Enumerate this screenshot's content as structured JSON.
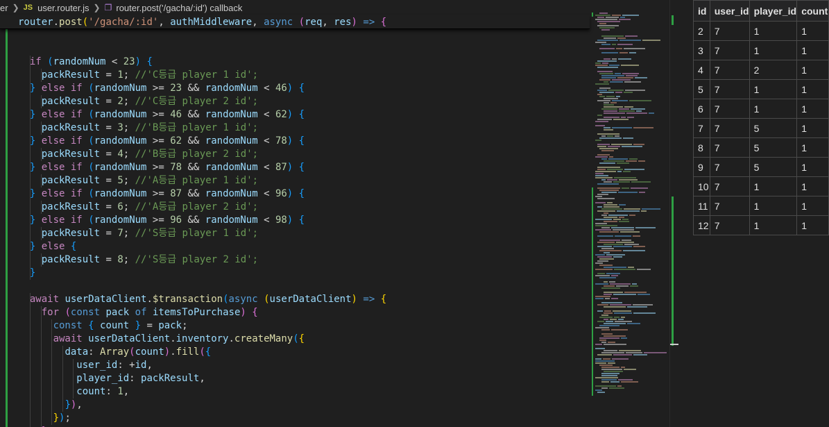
{
  "breadcrumb": {
    "parent": "er",
    "file_icon": "JS",
    "file": "user.router.js",
    "symbol": "router.post('/gacha/:id') callback"
  },
  "sticky_parts": [
    {
      "c": "var",
      "t": "router"
    },
    {
      "c": "op",
      "t": "."
    },
    {
      "c": "fn",
      "t": "post"
    },
    {
      "c": "b1",
      "t": "("
    },
    {
      "c": "str",
      "t": "'/gacha/:id'"
    },
    {
      "c": "op",
      "t": ", "
    },
    {
      "c": "var",
      "t": "authMiddleware"
    },
    {
      "c": "op",
      "t": ", "
    },
    {
      "c": "kb",
      "t": "async"
    },
    {
      "c": "op",
      "t": " "
    },
    {
      "c": "b2",
      "t": "("
    },
    {
      "c": "var",
      "t": "req"
    },
    {
      "c": "op",
      "t": ", "
    },
    {
      "c": "var",
      "t": "res"
    },
    {
      "c": "b2",
      "t": ")"
    },
    {
      "c": "op",
      "t": " "
    },
    {
      "c": "kb",
      "t": "=>"
    },
    {
      "c": "op",
      "t": " "
    },
    {
      "c": "b2",
      "t": "{"
    }
  ],
  "code_lines": [
    {
      "indent": 0,
      "parts": []
    },
    {
      "indent": 2,
      "parts": [
        {
          "c": "kw",
          "t": "if"
        },
        {
          "c": "op",
          "t": " "
        },
        {
          "c": "b3",
          "t": "("
        },
        {
          "c": "var",
          "t": "randomNum"
        },
        {
          "c": "op",
          "t": " < "
        },
        {
          "c": "num",
          "t": "23"
        },
        {
          "c": "b3",
          "t": ")"
        },
        {
          "c": "op",
          "t": " "
        },
        {
          "c": "b3",
          "t": "{"
        }
      ]
    },
    {
      "indent": 3,
      "parts": [
        {
          "c": "var",
          "t": "packResult"
        },
        {
          "c": "op",
          "t": " = "
        },
        {
          "c": "num",
          "t": "1"
        },
        {
          "c": "op",
          "t": "; "
        },
        {
          "c": "cm",
          "t": "//'C등급 player 1 id';"
        }
      ]
    },
    {
      "indent": 2,
      "parts": [
        {
          "c": "b3",
          "t": "}"
        },
        {
          "c": "op",
          "t": " "
        },
        {
          "c": "kw",
          "t": "else if"
        },
        {
          "c": "op",
          "t": " "
        },
        {
          "c": "b3",
          "t": "("
        },
        {
          "c": "var",
          "t": "randomNum"
        },
        {
          "c": "op",
          "t": " >= "
        },
        {
          "c": "num",
          "t": "23"
        },
        {
          "c": "op",
          "t": " && "
        },
        {
          "c": "var",
          "t": "randomNum"
        },
        {
          "c": "op",
          "t": " < "
        },
        {
          "c": "num",
          "t": "46"
        },
        {
          "c": "b3",
          "t": ")"
        },
        {
          "c": "op",
          "t": " "
        },
        {
          "c": "b3",
          "t": "{"
        }
      ]
    },
    {
      "indent": 3,
      "parts": [
        {
          "c": "var",
          "t": "packResult"
        },
        {
          "c": "op",
          "t": " = "
        },
        {
          "c": "num",
          "t": "2"
        },
        {
          "c": "op",
          "t": "; "
        },
        {
          "c": "cm",
          "t": "//'C등급 player 2 id';"
        }
      ]
    },
    {
      "indent": 2,
      "parts": [
        {
          "c": "b3",
          "t": "}"
        },
        {
          "c": "op",
          "t": " "
        },
        {
          "c": "kw",
          "t": "else if"
        },
        {
          "c": "op",
          "t": " "
        },
        {
          "c": "b3",
          "t": "("
        },
        {
          "c": "var",
          "t": "randomNum"
        },
        {
          "c": "op",
          "t": " >= "
        },
        {
          "c": "num",
          "t": "46"
        },
        {
          "c": "op",
          "t": " && "
        },
        {
          "c": "var",
          "t": "randomNum"
        },
        {
          "c": "op",
          "t": " < "
        },
        {
          "c": "num",
          "t": "62"
        },
        {
          "c": "b3",
          "t": ")"
        },
        {
          "c": "op",
          "t": " "
        },
        {
          "c": "b3",
          "t": "{"
        }
      ]
    },
    {
      "indent": 3,
      "parts": [
        {
          "c": "var",
          "t": "packResult"
        },
        {
          "c": "op",
          "t": " = "
        },
        {
          "c": "num",
          "t": "3"
        },
        {
          "c": "op",
          "t": "; "
        },
        {
          "c": "cm",
          "t": "//'B등급 player 1 id';"
        }
      ]
    },
    {
      "indent": 2,
      "parts": [
        {
          "c": "b3",
          "t": "}"
        },
        {
          "c": "op",
          "t": " "
        },
        {
          "c": "kw",
          "t": "else if"
        },
        {
          "c": "op",
          "t": " "
        },
        {
          "c": "b3",
          "t": "("
        },
        {
          "c": "var",
          "t": "randomNum"
        },
        {
          "c": "op",
          "t": " >= "
        },
        {
          "c": "num",
          "t": "62"
        },
        {
          "c": "op",
          "t": " && "
        },
        {
          "c": "var",
          "t": "randomNum"
        },
        {
          "c": "op",
          "t": " < "
        },
        {
          "c": "num",
          "t": "78"
        },
        {
          "c": "b3",
          "t": ")"
        },
        {
          "c": "op",
          "t": " "
        },
        {
          "c": "b3",
          "t": "{"
        }
      ]
    },
    {
      "indent": 3,
      "parts": [
        {
          "c": "var",
          "t": "packResult"
        },
        {
          "c": "op",
          "t": " = "
        },
        {
          "c": "num",
          "t": "4"
        },
        {
          "c": "op",
          "t": "; "
        },
        {
          "c": "cm",
          "t": "//'B등급 player 2 id';"
        }
      ]
    },
    {
      "indent": 2,
      "parts": [
        {
          "c": "b3",
          "t": "}"
        },
        {
          "c": "op",
          "t": " "
        },
        {
          "c": "kw",
          "t": "else if"
        },
        {
          "c": "op",
          "t": " "
        },
        {
          "c": "b3",
          "t": "("
        },
        {
          "c": "var",
          "t": "randomNum"
        },
        {
          "c": "op",
          "t": " >= "
        },
        {
          "c": "num",
          "t": "78"
        },
        {
          "c": "op",
          "t": " && "
        },
        {
          "c": "var",
          "t": "randomNum"
        },
        {
          "c": "op",
          "t": " < "
        },
        {
          "c": "num",
          "t": "87"
        },
        {
          "c": "b3",
          "t": ")"
        },
        {
          "c": "op",
          "t": " "
        },
        {
          "c": "b3",
          "t": "{"
        }
      ]
    },
    {
      "indent": 3,
      "parts": [
        {
          "c": "var",
          "t": "packResult"
        },
        {
          "c": "op",
          "t": " = "
        },
        {
          "c": "num",
          "t": "5"
        },
        {
          "c": "op",
          "t": "; "
        },
        {
          "c": "cm",
          "t": "//'A등급 player 1 id';"
        }
      ]
    },
    {
      "indent": 2,
      "parts": [
        {
          "c": "b3",
          "t": "}"
        },
        {
          "c": "op",
          "t": " "
        },
        {
          "c": "kw",
          "t": "else if"
        },
        {
          "c": "op",
          "t": " "
        },
        {
          "c": "b3",
          "t": "("
        },
        {
          "c": "var",
          "t": "randomNum"
        },
        {
          "c": "op",
          "t": " >= "
        },
        {
          "c": "num",
          "t": "87"
        },
        {
          "c": "op",
          "t": " && "
        },
        {
          "c": "var",
          "t": "randomNum"
        },
        {
          "c": "op",
          "t": " < "
        },
        {
          "c": "num",
          "t": "96"
        },
        {
          "c": "b3",
          "t": ")"
        },
        {
          "c": "op",
          "t": " "
        },
        {
          "c": "b3",
          "t": "{"
        }
      ]
    },
    {
      "indent": 3,
      "parts": [
        {
          "c": "var",
          "t": "packResult"
        },
        {
          "c": "op",
          "t": " = "
        },
        {
          "c": "num",
          "t": "6"
        },
        {
          "c": "op",
          "t": "; "
        },
        {
          "c": "cm",
          "t": "//'A등급 player 2 id';"
        }
      ]
    },
    {
      "indent": 2,
      "parts": [
        {
          "c": "b3",
          "t": "}"
        },
        {
          "c": "op",
          "t": " "
        },
        {
          "c": "kw",
          "t": "else if"
        },
        {
          "c": "op",
          "t": " "
        },
        {
          "c": "b3",
          "t": "("
        },
        {
          "c": "var",
          "t": "randomNum"
        },
        {
          "c": "op",
          "t": " >= "
        },
        {
          "c": "num",
          "t": "96"
        },
        {
          "c": "op",
          "t": " && "
        },
        {
          "c": "var",
          "t": "randomNum"
        },
        {
          "c": "op",
          "t": " < "
        },
        {
          "c": "num",
          "t": "98"
        },
        {
          "c": "b3",
          "t": ")"
        },
        {
          "c": "op",
          "t": " "
        },
        {
          "c": "b3",
          "t": "{"
        }
      ]
    },
    {
      "indent": 3,
      "parts": [
        {
          "c": "var",
          "t": "packResult"
        },
        {
          "c": "op",
          "t": " = "
        },
        {
          "c": "num",
          "t": "7"
        },
        {
          "c": "op",
          "t": "; "
        },
        {
          "c": "cm",
          "t": "//'S등급 player 1 id';"
        }
      ]
    },
    {
      "indent": 2,
      "parts": [
        {
          "c": "b3",
          "t": "}"
        },
        {
          "c": "op",
          "t": " "
        },
        {
          "c": "kw",
          "t": "else"
        },
        {
          "c": "op",
          "t": " "
        },
        {
          "c": "b3",
          "t": "{"
        }
      ]
    },
    {
      "indent": 3,
      "parts": [
        {
          "c": "var",
          "t": "packResult"
        },
        {
          "c": "op",
          "t": " = "
        },
        {
          "c": "num",
          "t": "8"
        },
        {
          "c": "op",
          "t": "; "
        },
        {
          "c": "cm",
          "t": "//'S등급 player 2 id';"
        }
      ]
    },
    {
      "indent": 2,
      "parts": [
        {
          "c": "b3",
          "t": "}"
        }
      ]
    },
    {
      "indent": 0,
      "parts": []
    },
    {
      "indent": 2,
      "parts": [
        {
          "c": "kw",
          "t": "await"
        },
        {
          "c": "op",
          "t": " "
        },
        {
          "c": "var",
          "t": "userDataClient"
        },
        {
          "c": "op",
          "t": "."
        },
        {
          "c": "fn",
          "t": "$transaction"
        },
        {
          "c": "b3",
          "t": "("
        },
        {
          "c": "kb",
          "t": "async"
        },
        {
          "c": "op",
          "t": " "
        },
        {
          "c": "b1",
          "t": "("
        },
        {
          "c": "var",
          "t": "userDataClient"
        },
        {
          "c": "b1",
          "t": ")"
        },
        {
          "c": "op",
          "t": " "
        },
        {
          "c": "kb",
          "t": "=>"
        },
        {
          "c": "op",
          "t": " "
        },
        {
          "c": "b1",
          "t": "{"
        }
      ]
    },
    {
      "indent": 3,
      "parts": [
        {
          "c": "kw",
          "t": "for"
        },
        {
          "c": "op",
          "t": " "
        },
        {
          "c": "b2",
          "t": "("
        },
        {
          "c": "kb",
          "t": "const"
        },
        {
          "c": "op",
          "t": " "
        },
        {
          "c": "var",
          "t": "pack"
        },
        {
          "c": "op",
          "t": " "
        },
        {
          "c": "kb",
          "t": "of"
        },
        {
          "c": "op",
          "t": " "
        },
        {
          "c": "var",
          "t": "itemsToPurchase"
        },
        {
          "c": "b2",
          "t": ")"
        },
        {
          "c": "op",
          "t": " "
        },
        {
          "c": "b2",
          "t": "{"
        }
      ]
    },
    {
      "indent": 4,
      "parts": [
        {
          "c": "kb",
          "t": "const"
        },
        {
          "c": "op",
          "t": " "
        },
        {
          "c": "b3",
          "t": "{"
        },
        {
          "c": "op",
          "t": " "
        },
        {
          "c": "var",
          "t": "count"
        },
        {
          "c": "op",
          "t": " "
        },
        {
          "c": "b3",
          "t": "}"
        },
        {
          "c": "op",
          "t": " = "
        },
        {
          "c": "var",
          "t": "pack"
        },
        {
          "c": "op",
          "t": ";"
        }
      ]
    },
    {
      "indent": 4,
      "parts": [
        {
          "c": "kw",
          "t": "await"
        },
        {
          "c": "op",
          "t": " "
        },
        {
          "c": "var",
          "t": "userDataClient"
        },
        {
          "c": "op",
          "t": "."
        },
        {
          "c": "var",
          "t": "inventory"
        },
        {
          "c": "op",
          "t": "."
        },
        {
          "c": "fn",
          "t": "createMany"
        },
        {
          "c": "b3",
          "t": "("
        },
        {
          "c": "b1",
          "t": "{"
        }
      ]
    },
    {
      "indent": 5,
      "parts": [
        {
          "c": "var",
          "t": "data"
        },
        {
          "c": "op",
          "t": ": "
        },
        {
          "c": "fn",
          "t": "Array"
        },
        {
          "c": "b2",
          "t": "("
        },
        {
          "c": "var",
          "t": "count"
        },
        {
          "c": "b2",
          "t": ")"
        },
        {
          "c": "op",
          "t": "."
        },
        {
          "c": "fn",
          "t": "fill"
        },
        {
          "c": "b2",
          "t": "("
        },
        {
          "c": "b3",
          "t": "{"
        }
      ]
    },
    {
      "indent": 6,
      "parts": [
        {
          "c": "var",
          "t": "user_id"
        },
        {
          "c": "op",
          "t": ": +"
        },
        {
          "c": "var",
          "t": "id"
        },
        {
          "c": "op",
          "t": ","
        }
      ]
    },
    {
      "indent": 6,
      "parts": [
        {
          "c": "var",
          "t": "player_id"
        },
        {
          "c": "op",
          "t": ": "
        },
        {
          "c": "var",
          "t": "packResult"
        },
        {
          "c": "op",
          "t": ","
        }
      ]
    },
    {
      "indent": 6,
      "parts": [
        {
          "c": "var",
          "t": "count"
        },
        {
          "c": "op",
          "t": ": "
        },
        {
          "c": "num",
          "t": "1"
        },
        {
          "c": "op",
          "t": ","
        }
      ]
    },
    {
      "indent": 5,
      "parts": [
        {
          "c": "b3",
          "t": "}"
        },
        {
          "c": "b2",
          "t": ")"
        },
        {
          "c": "op",
          "t": ","
        }
      ]
    },
    {
      "indent": 4,
      "parts": [
        {
          "c": "b1",
          "t": "}"
        },
        {
          "c": "b3",
          "t": ")"
        },
        {
          "c": "op",
          "t": ";"
        }
      ]
    },
    {
      "indent": 3,
      "parts": [
        {
          "c": "b2",
          "t": "}"
        }
      ]
    }
  ],
  "table": {
    "columns": [
      "id",
      "user_id",
      "player_id",
      "count"
    ],
    "rows": [
      [
        "2",
        "7",
        "1",
        "1"
      ],
      [
        "3",
        "7",
        "1",
        "1"
      ],
      [
        "4",
        "7",
        "2",
        "1"
      ],
      [
        "5",
        "7",
        "1",
        "1"
      ],
      [
        "6",
        "7",
        "1",
        "1"
      ],
      [
        "7",
        "7",
        "5",
        "1"
      ],
      [
        "8",
        "7",
        "5",
        "1"
      ],
      [
        "9",
        "7",
        "5",
        "1"
      ],
      [
        "10",
        "7",
        "1",
        "1"
      ],
      [
        "11",
        "7",
        "1",
        "1"
      ],
      [
        "12",
        "7",
        "1",
        "1"
      ]
    ]
  },
  "colors": {
    "git_added": "#2ea043",
    "editor_bg": "#1f1f1f"
  }
}
